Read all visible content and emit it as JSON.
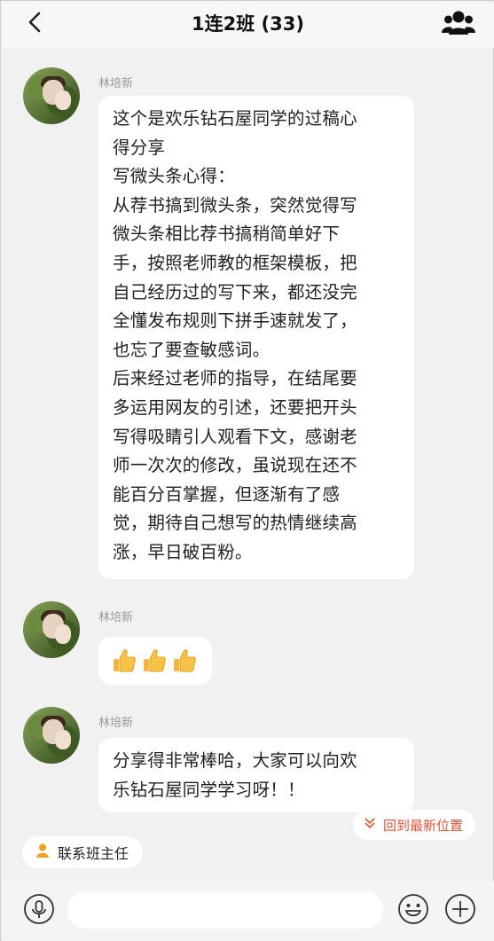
{
  "header": {
    "title": "1连2班 (33)",
    "back_icon": "chevron-left-icon",
    "members_icon": "group-icon"
  },
  "messages": [
    {
      "sender": "林培新",
      "text": "这个是欢乐钻石屋同学的过稿心\n得分享\n写微头条心得：\n从荐书搞到微头条，突然觉得写\n微头条相比荐书搞稍简单好下\n手，按照老师教的框架模板，把\n自己经历过的写下来，都还没完\n全懂发布规则下拼手速就发了，\n也忘了要查敏感词。\n后来经过老师的指导，在结尾要\n多运用网友的引述，还要把开头\n写得吸睛引人观看下文，感谢老\n师一次次的修改，虽说现在还不\n能百分百掌握，但逐渐有了感\n觉，期待自己想写的热情继续高\n涨，早日破百粉。"
    },
    {
      "sender": "林培新",
      "emoji": "thumbs-up-icon",
      "emoji_count": 3
    },
    {
      "sender": "林培新",
      "text": "分享得非常棒哈，大家可以向欢\n乐钻石屋同学学习呀！！"
    }
  ],
  "latest_button": {
    "label": "回到最新位置",
    "icon": "double-chevron-down-icon",
    "color": "#e0553a"
  },
  "contact_button": {
    "label": "联系班主任",
    "icon": "person-icon",
    "icon_color": "#f0a020"
  },
  "input_bar": {
    "placeholder": "",
    "voice_icon": "microphone-icon",
    "emoji_icon": "smiley-icon",
    "plus_icon": "plus-circle-icon"
  }
}
